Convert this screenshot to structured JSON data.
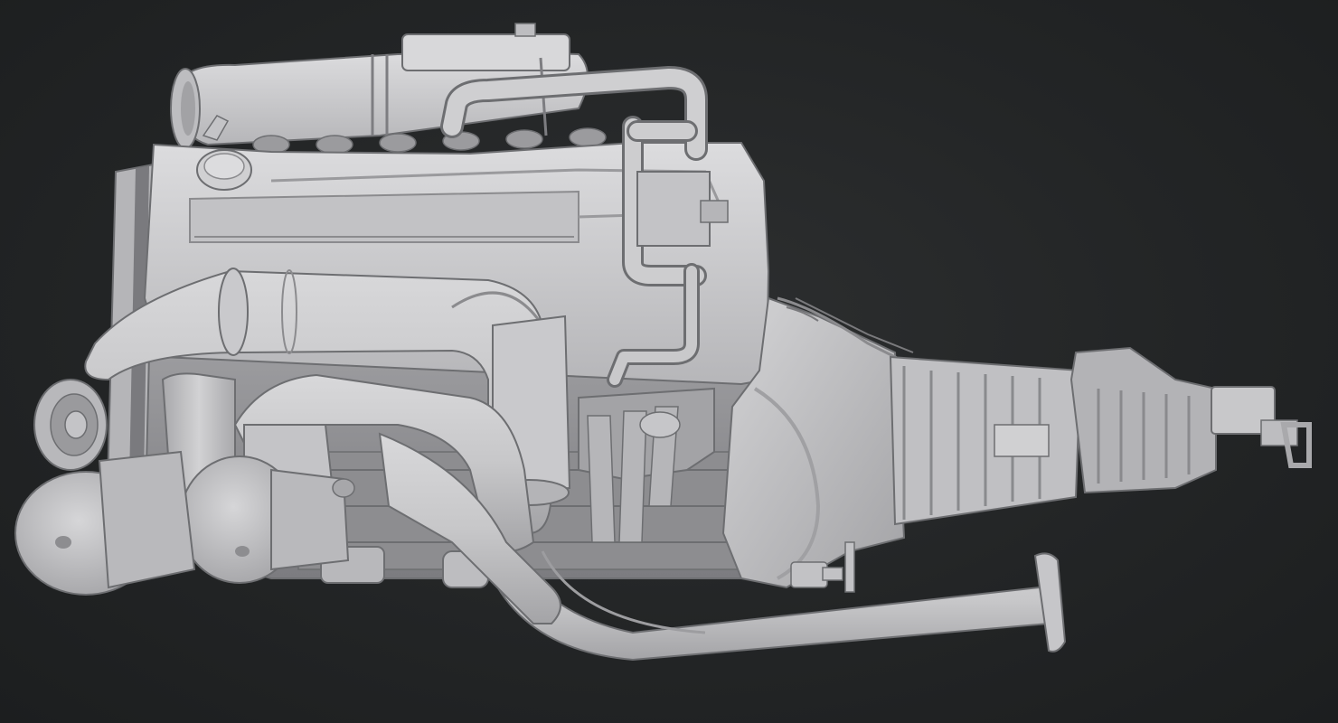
{
  "scene": {
    "subject": "engine-transmission-render",
    "background_color": "#252728",
    "model_color": "#c9c9cb",
    "shadow_color": "#8f9093",
    "highlight_color": "#e2e2e4",
    "outline_color": "#6d6e71"
  }
}
